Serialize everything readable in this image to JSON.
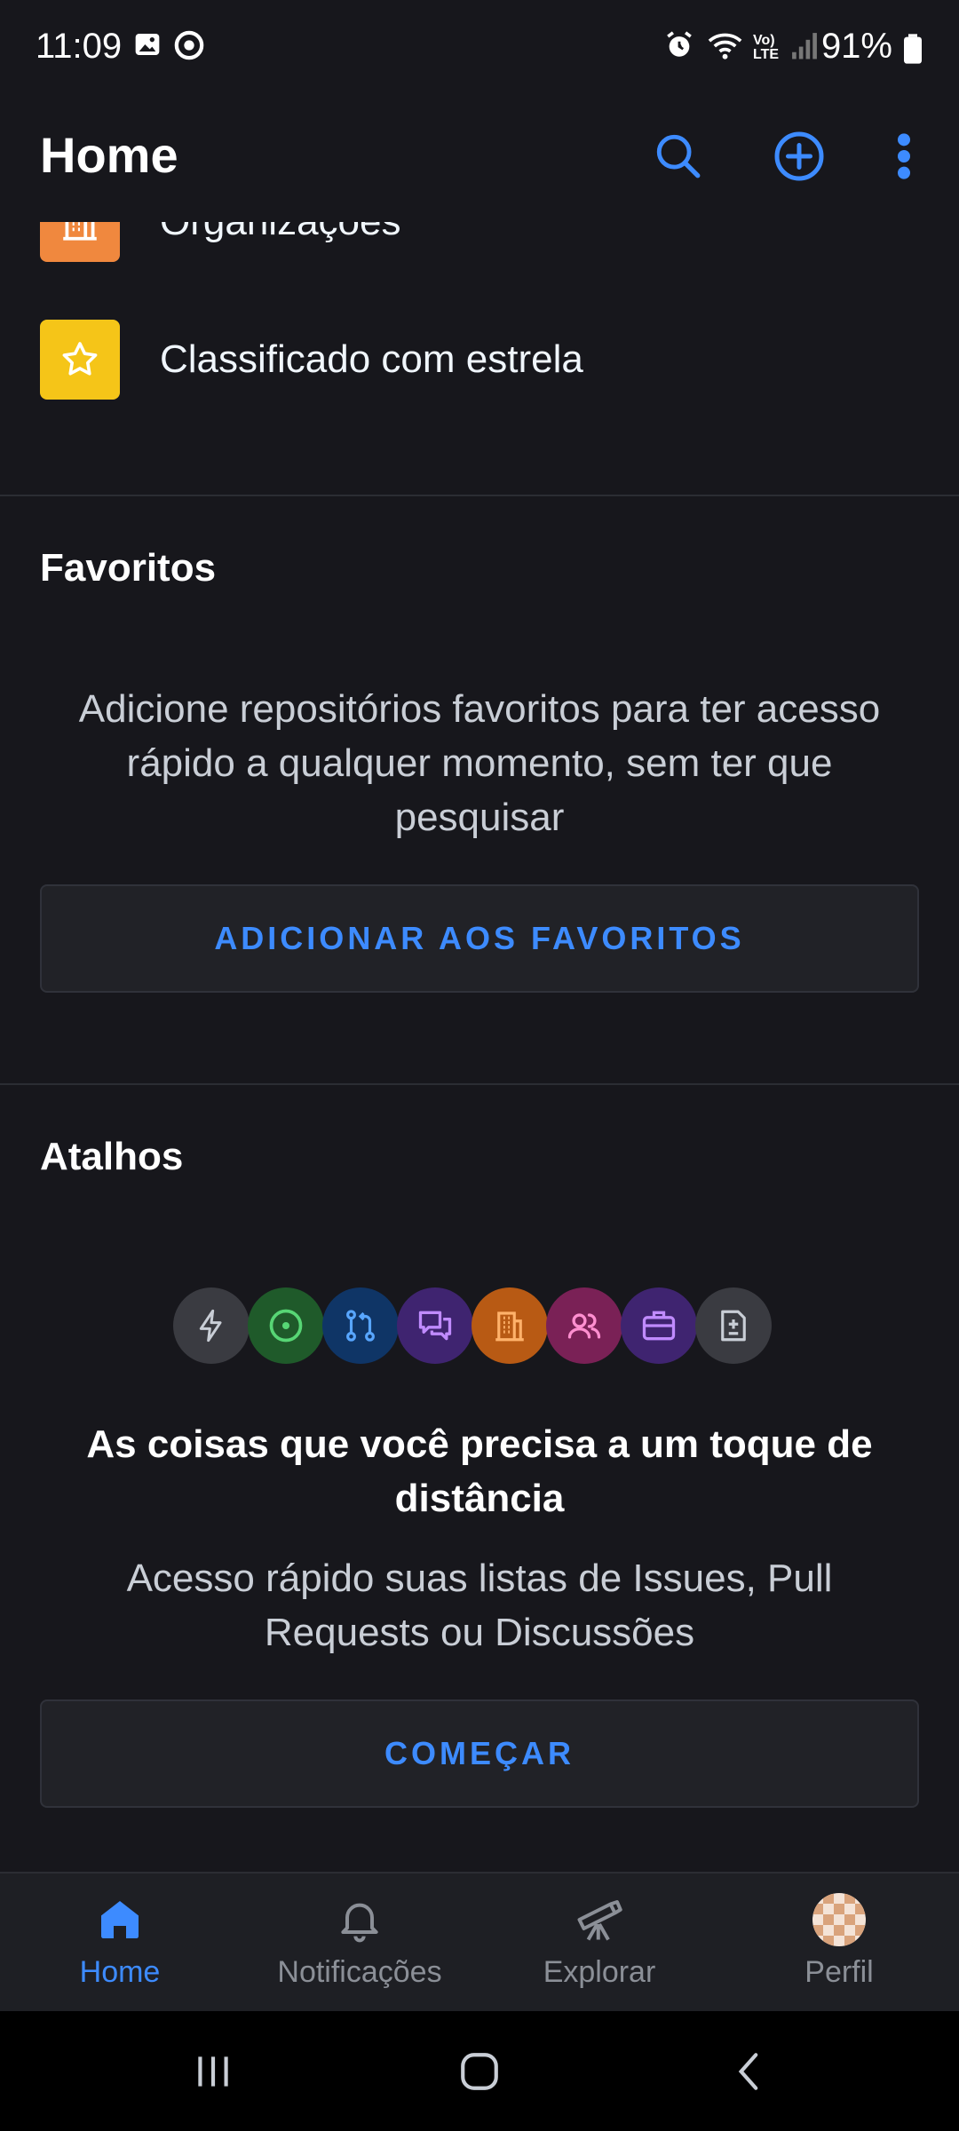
{
  "status_bar": {
    "time": "11:09",
    "battery": "91%",
    "icons": [
      "gallery-icon",
      "sync-icon",
      "alarm-icon",
      "wifi-icon",
      "volte-icon",
      "signal-icon",
      "battery-icon"
    ]
  },
  "header": {
    "title": "Home",
    "icons": [
      "search-icon",
      "add-circle-icon",
      "more-vertical-icon"
    ]
  },
  "my_work": {
    "items": [
      {
        "label": "Organizações",
        "icon": "organization-icon",
        "color": "#f0883e"
      },
      {
        "label": "Classificado com estrela",
        "icon": "star-icon",
        "color": "#f5c518"
      }
    ]
  },
  "favorites": {
    "title": "Favoritos",
    "description": "Adicione repositórios favoritos para ter acesso rápido a qualquer momento, sem ter que pesquisar",
    "button_label": "ADICIONAR AOS FAVORITOS"
  },
  "shortcuts": {
    "title": "Atalhos",
    "icons": [
      {
        "name": "zap-icon",
        "color": "#3a3b41"
      },
      {
        "name": "issue-icon",
        "color": "#1f5a2a"
      },
      {
        "name": "pull-request-icon",
        "color": "#0f3566"
      },
      {
        "name": "discussion-icon",
        "color": "#3f2470"
      },
      {
        "name": "organization-icon",
        "color": "#b85a14"
      },
      {
        "name": "people-icon",
        "color": "#7a2156"
      },
      {
        "name": "briefcase-icon",
        "color": "#3f2470"
      },
      {
        "name": "file-diff-icon",
        "color": "#3a3b41"
      }
    ],
    "headline": "As coisas que você precisa a um toque de distância",
    "description": "Acesso rápido suas listas de Issues, Pull Requests ou Discussões",
    "button_label": "COMEÇAR"
  },
  "bottom_nav": {
    "tabs": [
      {
        "label": "Home",
        "icon": "home-icon",
        "active": true
      },
      {
        "label": "Notificações",
        "icon": "bell-icon",
        "active": false
      },
      {
        "label": "Explorar",
        "icon": "telescope-icon",
        "active": false
      },
      {
        "label": "Perfil",
        "icon": "avatar",
        "active": false
      }
    ]
  },
  "colors": {
    "accent": "#3d8bff",
    "background": "#17171c"
  }
}
